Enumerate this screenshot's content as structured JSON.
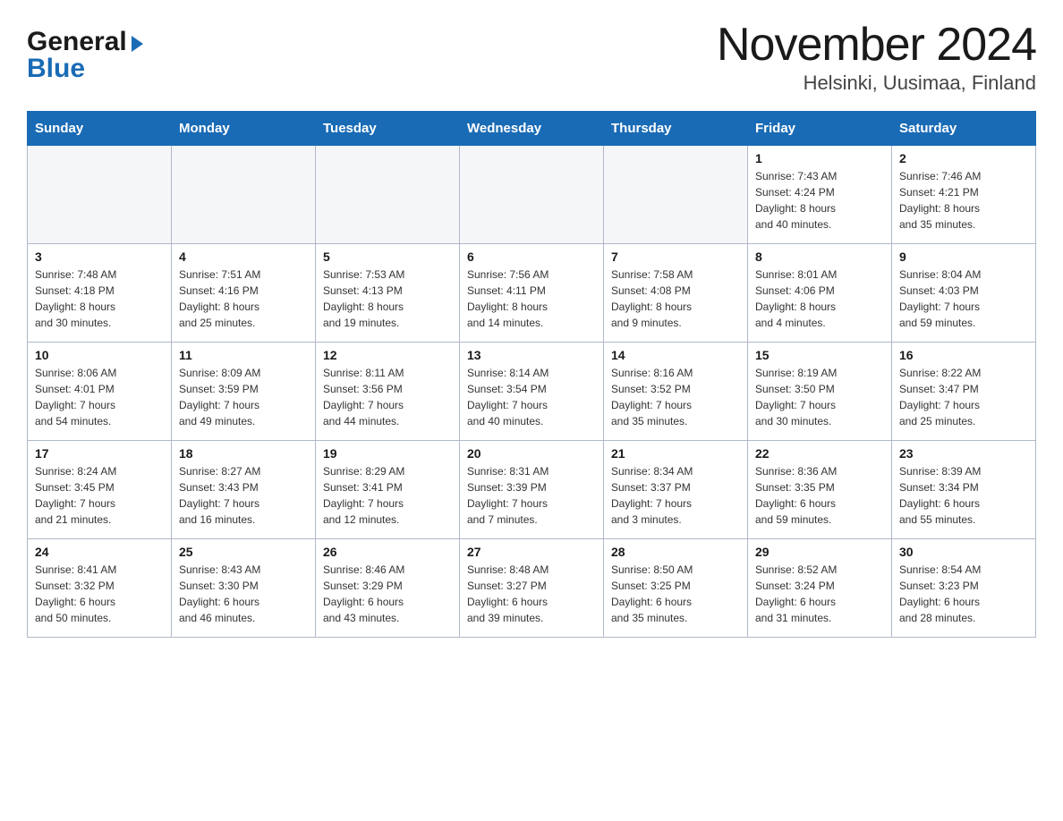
{
  "header": {
    "logo": {
      "general": "General",
      "blue": "Blue",
      "arrow": "▶"
    },
    "month_title": "November 2024",
    "location": "Helsinki, Uusimaa, Finland"
  },
  "days_of_week": [
    "Sunday",
    "Monday",
    "Tuesday",
    "Wednesday",
    "Thursday",
    "Friday",
    "Saturday"
  ],
  "weeks": [
    [
      {
        "day": "",
        "info": ""
      },
      {
        "day": "",
        "info": ""
      },
      {
        "day": "",
        "info": ""
      },
      {
        "day": "",
        "info": ""
      },
      {
        "day": "",
        "info": ""
      },
      {
        "day": "1",
        "info": "Sunrise: 7:43 AM\nSunset: 4:24 PM\nDaylight: 8 hours\nand 40 minutes."
      },
      {
        "day": "2",
        "info": "Sunrise: 7:46 AM\nSunset: 4:21 PM\nDaylight: 8 hours\nand 35 minutes."
      }
    ],
    [
      {
        "day": "3",
        "info": "Sunrise: 7:48 AM\nSunset: 4:18 PM\nDaylight: 8 hours\nand 30 minutes."
      },
      {
        "day": "4",
        "info": "Sunrise: 7:51 AM\nSunset: 4:16 PM\nDaylight: 8 hours\nand 25 minutes."
      },
      {
        "day": "5",
        "info": "Sunrise: 7:53 AM\nSunset: 4:13 PM\nDaylight: 8 hours\nand 19 minutes."
      },
      {
        "day": "6",
        "info": "Sunrise: 7:56 AM\nSunset: 4:11 PM\nDaylight: 8 hours\nand 14 minutes."
      },
      {
        "day": "7",
        "info": "Sunrise: 7:58 AM\nSunset: 4:08 PM\nDaylight: 8 hours\nand 9 minutes."
      },
      {
        "day": "8",
        "info": "Sunrise: 8:01 AM\nSunset: 4:06 PM\nDaylight: 8 hours\nand 4 minutes."
      },
      {
        "day": "9",
        "info": "Sunrise: 8:04 AM\nSunset: 4:03 PM\nDaylight: 7 hours\nand 59 minutes."
      }
    ],
    [
      {
        "day": "10",
        "info": "Sunrise: 8:06 AM\nSunset: 4:01 PM\nDaylight: 7 hours\nand 54 minutes."
      },
      {
        "day": "11",
        "info": "Sunrise: 8:09 AM\nSunset: 3:59 PM\nDaylight: 7 hours\nand 49 minutes."
      },
      {
        "day": "12",
        "info": "Sunrise: 8:11 AM\nSunset: 3:56 PM\nDaylight: 7 hours\nand 44 minutes."
      },
      {
        "day": "13",
        "info": "Sunrise: 8:14 AM\nSunset: 3:54 PM\nDaylight: 7 hours\nand 40 minutes."
      },
      {
        "day": "14",
        "info": "Sunrise: 8:16 AM\nSunset: 3:52 PM\nDaylight: 7 hours\nand 35 minutes."
      },
      {
        "day": "15",
        "info": "Sunrise: 8:19 AM\nSunset: 3:50 PM\nDaylight: 7 hours\nand 30 minutes."
      },
      {
        "day": "16",
        "info": "Sunrise: 8:22 AM\nSunset: 3:47 PM\nDaylight: 7 hours\nand 25 minutes."
      }
    ],
    [
      {
        "day": "17",
        "info": "Sunrise: 8:24 AM\nSunset: 3:45 PM\nDaylight: 7 hours\nand 21 minutes."
      },
      {
        "day": "18",
        "info": "Sunrise: 8:27 AM\nSunset: 3:43 PM\nDaylight: 7 hours\nand 16 minutes."
      },
      {
        "day": "19",
        "info": "Sunrise: 8:29 AM\nSunset: 3:41 PM\nDaylight: 7 hours\nand 12 minutes."
      },
      {
        "day": "20",
        "info": "Sunrise: 8:31 AM\nSunset: 3:39 PM\nDaylight: 7 hours\nand 7 minutes."
      },
      {
        "day": "21",
        "info": "Sunrise: 8:34 AM\nSunset: 3:37 PM\nDaylight: 7 hours\nand 3 minutes."
      },
      {
        "day": "22",
        "info": "Sunrise: 8:36 AM\nSunset: 3:35 PM\nDaylight: 6 hours\nand 59 minutes."
      },
      {
        "day": "23",
        "info": "Sunrise: 8:39 AM\nSunset: 3:34 PM\nDaylight: 6 hours\nand 55 minutes."
      }
    ],
    [
      {
        "day": "24",
        "info": "Sunrise: 8:41 AM\nSunset: 3:32 PM\nDaylight: 6 hours\nand 50 minutes."
      },
      {
        "day": "25",
        "info": "Sunrise: 8:43 AM\nSunset: 3:30 PM\nDaylight: 6 hours\nand 46 minutes."
      },
      {
        "day": "26",
        "info": "Sunrise: 8:46 AM\nSunset: 3:29 PM\nDaylight: 6 hours\nand 43 minutes."
      },
      {
        "day": "27",
        "info": "Sunrise: 8:48 AM\nSunset: 3:27 PM\nDaylight: 6 hours\nand 39 minutes."
      },
      {
        "day": "28",
        "info": "Sunrise: 8:50 AM\nSunset: 3:25 PM\nDaylight: 6 hours\nand 35 minutes."
      },
      {
        "day": "29",
        "info": "Sunrise: 8:52 AM\nSunset: 3:24 PM\nDaylight: 6 hours\nand 31 minutes."
      },
      {
        "day": "30",
        "info": "Sunrise: 8:54 AM\nSunset: 3:23 PM\nDaylight: 6 hours\nand 28 minutes."
      }
    ]
  ]
}
